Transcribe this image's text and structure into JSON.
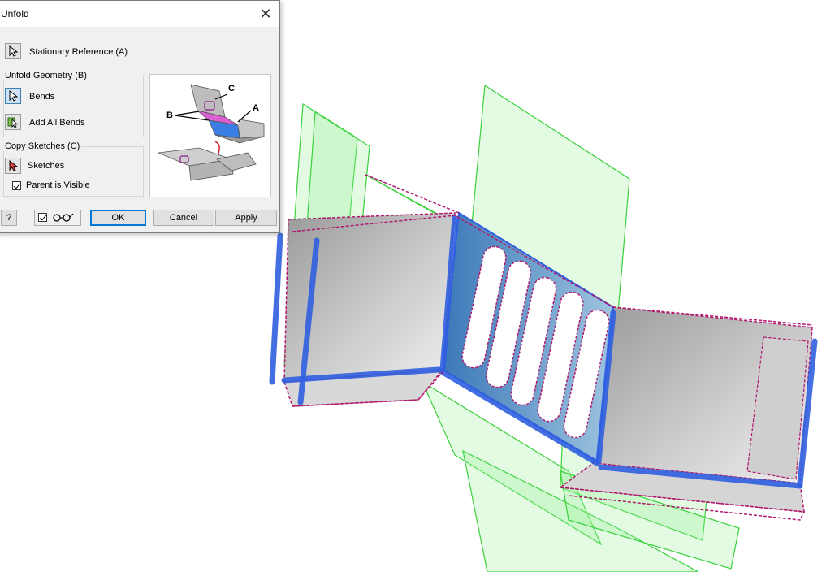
{
  "dialog": {
    "title": "Unfold",
    "close_symbol": "✕",
    "stationary_reference": "Stationary Reference (A)",
    "unfold_geometry": {
      "title": "Unfold Geometry (B)",
      "bends": "Bends",
      "add_all_bends": "Add All Bends"
    },
    "copy_sketches": {
      "title": "Copy Sketches (C)",
      "sketches": "Sketches",
      "parent_visible": "Parent is Visible",
      "parent_visible_checked": true
    },
    "preview_callouts": [
      "C",
      "B",
      "A"
    ],
    "footer": {
      "help_symbol": "?",
      "ok": "OK",
      "cancel": "Cancel",
      "apply": "Apply"
    }
  },
  "icons": [
    "close-icon",
    "cursor-arrow-icon",
    "add-all-bends-icon",
    "sketch-cursor-icon",
    "help-icon",
    "glasses-icon",
    "checkbox-icon"
  ],
  "colors": {
    "wireframe_green": "#3ad13a",
    "bend_blue": "#2f5fe0",
    "sketch_magenta": "#b0196e",
    "part_gray": "#b8b8b8"
  }
}
